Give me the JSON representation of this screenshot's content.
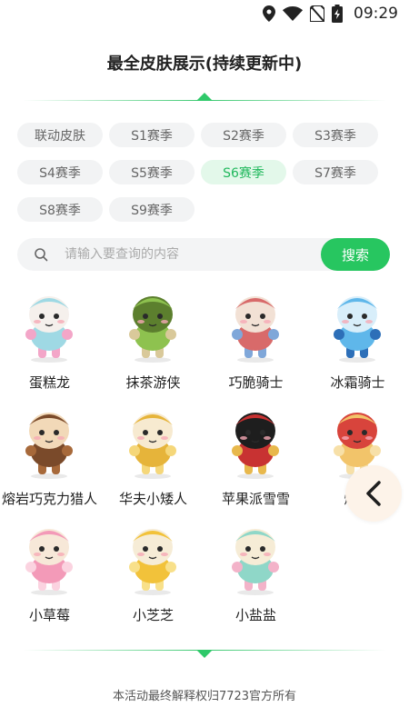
{
  "status_bar": {
    "time": "09:29",
    "icons": [
      "location-icon",
      "wifi-icon",
      "no-sim-icon",
      "battery-charging-icon"
    ]
  },
  "page": {
    "title": "最全皮肤展示(持续更新中)",
    "footer": "本活动最终解释权归7723官方所有"
  },
  "seasons": {
    "items": [
      {
        "label": "联动皮肤",
        "active": false
      },
      {
        "label": "S1赛季",
        "active": false
      },
      {
        "label": "S2赛季",
        "active": false
      },
      {
        "label": "S3赛季",
        "active": false
      },
      {
        "label": "S4赛季",
        "active": false
      },
      {
        "label": "S5赛季",
        "active": false
      },
      {
        "label": "S6赛季",
        "active": true
      },
      {
        "label": "S7赛季",
        "active": false
      },
      {
        "label": "S8赛季",
        "active": false
      },
      {
        "label": "S9赛季",
        "active": false
      }
    ]
  },
  "search": {
    "placeholder": "请输入要查询的内容",
    "value": "",
    "button_label": "搜索",
    "icon": "search-icon"
  },
  "skins": [
    {
      "name": "蛋糕龙",
      "colors": [
        "#9fd9e4",
        "#f3a6c8",
        "#f5f0ec"
      ],
      "icon": "cake-dragon-figure"
    },
    {
      "name": "抹茶游侠",
      "colors": [
        "#8ec24f",
        "#d9c99a",
        "#5c7f2e"
      ],
      "icon": "matcha-ranger-figure"
    },
    {
      "name": "巧脆骑士",
      "colors": [
        "#d86a6a",
        "#7fa7d9",
        "#f2e1d5"
      ],
      "icon": "crispy-knight-figure"
    },
    {
      "name": "冰霜骑士",
      "colors": [
        "#5fb7ea",
        "#2d6fb8",
        "#d8eefa"
      ],
      "icon": "frost-knight-figure"
    },
    {
      "name": "熔岩巧克力猎人",
      "colors": [
        "#7a4a2a",
        "#a7693a",
        "#f2d9b8"
      ],
      "icon": "lava-chocolate-hunter-figure"
    },
    {
      "name": "华夫小矮人",
      "colors": [
        "#e6b43a",
        "#f5d77a",
        "#f7ead0"
      ],
      "icon": "waffle-dwarf-figure"
    },
    {
      "name": "苹果派雪雪",
      "colors": [
        "#c83232",
        "#e8b84c",
        "#1e1e1e"
      ],
      "icon": "apple-pie-snow-figure"
    },
    {
      "name": "爆米",
      "colors": [
        "#f2c46a",
        "#f7e0a8",
        "#d8443c"
      ],
      "icon": "popcorn-figure"
    },
    {
      "name": "小草莓",
      "colors": [
        "#f39ab8",
        "#fbd3e0",
        "#f7e8d8"
      ],
      "icon": "little-strawberry-figure"
    },
    {
      "name": "小芝芝",
      "colors": [
        "#f2c23a",
        "#f8e08a",
        "#f6ecd6"
      ],
      "icon": "little-cheese-figure"
    },
    {
      "name": "小盐盐",
      "colors": [
        "#8fd7c8",
        "#f3b3c9",
        "#f6ecd6"
      ],
      "icon": "little-salt-figure"
    }
  ],
  "fab": {
    "icon": "chevron-left-icon"
  }
}
